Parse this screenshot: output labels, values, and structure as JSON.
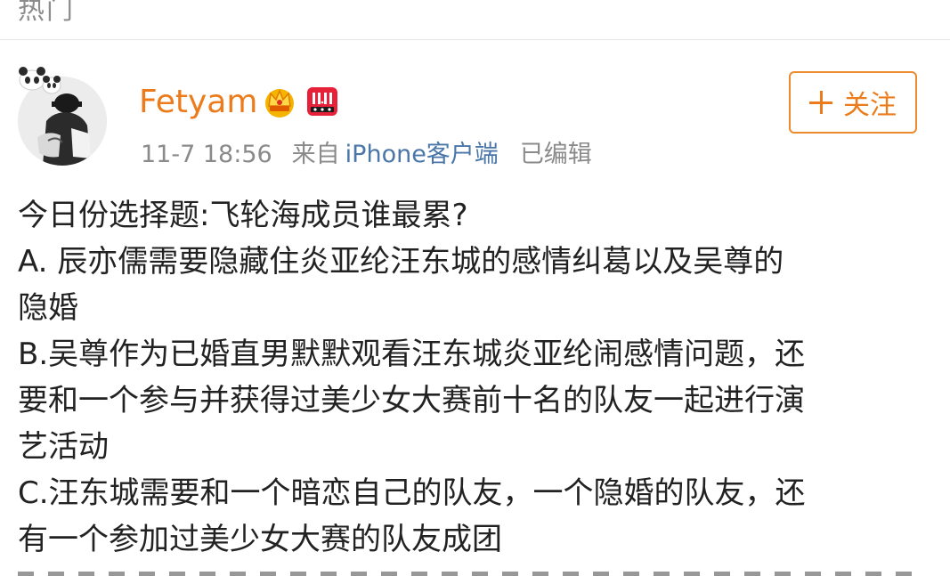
{
  "section_label": "热门",
  "post": {
    "author": {
      "name": "Fetyam",
      "avatar_icon": "user-avatar",
      "badges": [
        "crown-badge-icon",
        "double-eleven-badge-icon"
      ]
    },
    "meta": {
      "timestamp": "11-7 18:56",
      "source_prefix": "来自",
      "source": "iPhone客户端",
      "edited": "已编辑"
    },
    "follow_button": {
      "label": "关注",
      "icon": "plus-icon"
    },
    "content_lines": [
      "今日份选择题:飞轮海成员谁最累?",
      "A. 辰亦儒需要隐藏住炎亚纶汪东城的感情纠葛以及吴尊的",
      "隐婚",
      "B.吴尊作为已婚直男默默观看汪东城炎亚纶闹感情问题，还",
      "要和一个参与并获得过美少女大赛前十名的队友一起进行演",
      "艺活动",
      "C.汪东城需要和一个暗恋自己的队友，一个隐婚的队友，还",
      "有一个参加过美少女大赛的队友成团"
    ]
  },
  "colors": {
    "accent": "#ec7b1b",
    "link": "#4a76a8",
    "meta_text": "#8a8a8a",
    "body_text": "#222222"
  }
}
